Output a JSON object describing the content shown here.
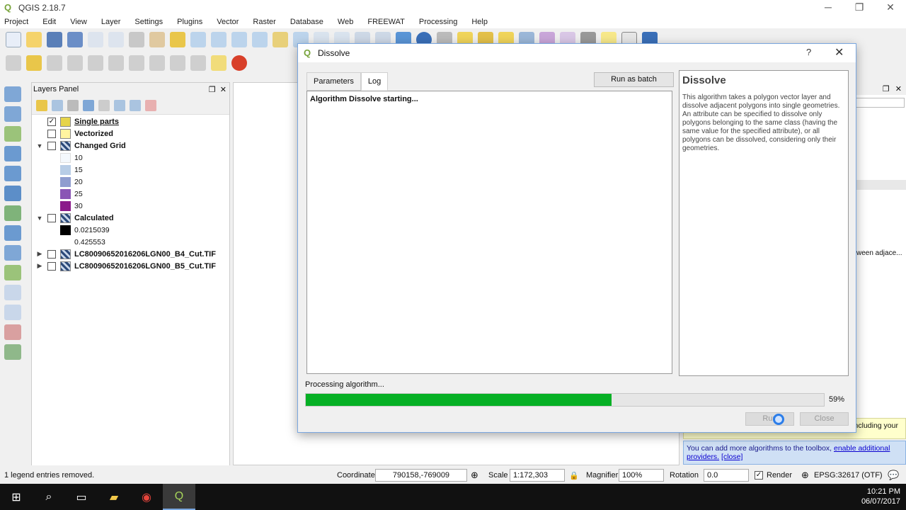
{
  "window": {
    "title": "QGIS 2.18.7"
  },
  "menu": [
    "Project",
    "Edit",
    "View",
    "Layer",
    "Settings",
    "Plugins",
    "Vector",
    "Raster",
    "Database",
    "Web",
    "FREEWAT",
    "Processing",
    "Help"
  ],
  "layers_panel": {
    "title": "Layers Panel",
    "items": [
      {
        "name": "Single parts",
        "checked": true,
        "expander": "",
        "swatch": "#e6d44a"
      },
      {
        "name": "Vectorized",
        "checked": false,
        "expander": "",
        "swatch": "#fff4a0"
      },
      {
        "name": "Changed Grid",
        "checked": false,
        "expander": "▼",
        "swatch": "#7a8fb0"
      },
      {
        "name": "Calculated",
        "checked": false,
        "expander": "▼",
        "swatch": "#7a8fb0"
      },
      {
        "name": "LC80090652016206LGN00_B4_Cut.TIF",
        "checked": false,
        "expander": "▶",
        "swatch": "#7a8fb0"
      },
      {
        "name": "LC80090652016206LGN00_B5_Cut.TIF",
        "checked": false,
        "expander": "▶",
        "swatch": "#7a8fb0"
      }
    ],
    "changed_grid_legend": [
      {
        "label": "10",
        "color": "#f4f8fc"
      },
      {
        "label": "15",
        "color": "#b8cde6"
      },
      {
        "label": "20",
        "color": "#8f9dcf"
      },
      {
        "label": "25",
        "color": "#8a56b5"
      },
      {
        "label": "30",
        "color": "#8b1a8a"
      }
    ],
    "calculated_legend": [
      {
        "label": "0.0215039",
        "color": "#000000"
      },
      {
        "label": "0.425553",
        "color": "#ffffff"
      }
    ]
  },
  "dialog": {
    "title": "Dissolve",
    "help_button": "?",
    "close_icon": "✕",
    "tabs": [
      "Parameters",
      "Log"
    ],
    "selected_tab": "Log",
    "batch_button": "Run as batch process...",
    "log_text": "Algorithm Dissolve starting...",
    "help_title": "Dissolve",
    "help_text": "This algorithm takes a polygon vector layer and dissolve adjacent polygons into single geometries. An attribute can be specified to dissolve only polygons belonging to the same class (having the same value for the specified attribute), or all polygons can be dissolved, considering only their geometries.",
    "status": "Processing algorithm...",
    "progress": 59,
    "progress_label": "59%",
    "run_button": "Run",
    "close_button": "Close"
  },
  "right_panel": {
    "truncated_text": "ween adjace...",
    "info_yellow": "ncluding your",
    "info_blue_text": "You can add more algorithms to the toolbox,",
    "info_blue_link": "enable additional providers.",
    "info_blue_close": "[close]"
  },
  "statusbar": {
    "message": "1 legend entries removed.",
    "coordinate_label": "Coordinate",
    "coordinate": "790158,-769009",
    "scale_label": "Scale",
    "scale": "1:172,303",
    "magnifier_label": "Magnifier",
    "magnifier": "100%",
    "rotation_label": "Rotation",
    "rotation": "0.0",
    "render_label": "Render",
    "crs": "EPSG:32617 (OTF)"
  },
  "taskbar": {
    "time": "10:21 PM",
    "date": "06/07/2017"
  },
  "colors": {
    "progress": "#06b025",
    "qgis_green": "#77a33a",
    "dialog_border": "#7aa7e0"
  }
}
